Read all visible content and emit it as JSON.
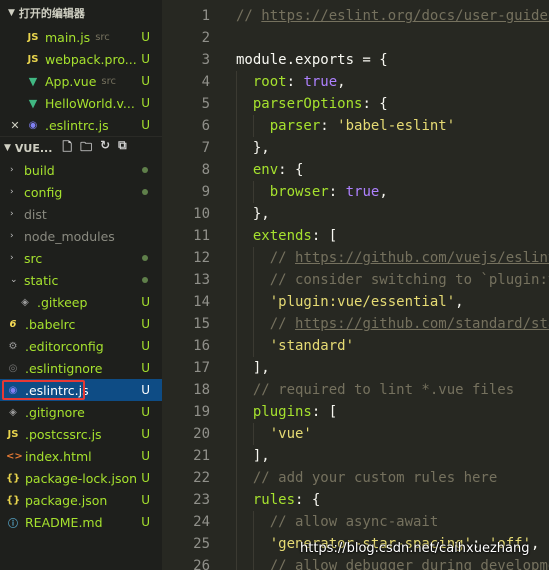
{
  "sidebar": {
    "open_editors_title": "打开的编辑器",
    "open_editors": [
      {
        "icon": "JS",
        "icon_class": "i-js",
        "name": "main.js",
        "desc": "src",
        "status": "U",
        "close": false
      },
      {
        "icon": "JS",
        "icon_class": "i-js",
        "name": "webpack.pro...",
        "desc": "",
        "status": "U",
        "close": false
      },
      {
        "icon": "▼",
        "icon_class": "i-vue",
        "name": "App.vue",
        "desc": "src",
        "status": "U",
        "close": false
      },
      {
        "icon": "▼",
        "icon_class": "i-vue",
        "name": "HelloWorld.v...",
        "desc": "",
        "status": "U",
        "close": false
      },
      {
        "icon": "◉",
        "icon_class": "i-eslint",
        "name": ".eslintrc.js",
        "desc": "",
        "status": "U",
        "close": true
      }
    ],
    "project_title": "VUE...",
    "project_tools": [
      "new-file-icon",
      "new-folder-icon",
      "refresh-icon",
      "collapse-all-icon"
    ],
    "tree": [
      {
        "kind": "folder",
        "caret": "›",
        "name": "build",
        "marker": "dot",
        "gray": false
      },
      {
        "kind": "folder",
        "caret": "›",
        "name": "config",
        "marker": "dot",
        "gray": false
      },
      {
        "kind": "folder",
        "caret": "›",
        "name": "dist",
        "marker": "",
        "gray": true
      },
      {
        "kind": "folder",
        "caret": "›",
        "name": "node_modules",
        "marker": "",
        "gray": true
      },
      {
        "kind": "folder",
        "caret": "›",
        "name": "src",
        "marker": "dot",
        "gray": false
      },
      {
        "kind": "folder",
        "caret": "⌄",
        "name": "static",
        "marker": "dot",
        "gray": false
      },
      {
        "kind": "file",
        "indent": true,
        "icon": "◈",
        "icon_class": "i-git",
        "name": ".gitkeep",
        "marker": "U"
      },
      {
        "kind": "file",
        "icon": "6",
        "icon_class": "i-babel",
        "name": ".babelrc",
        "marker": "U"
      },
      {
        "kind": "file",
        "icon": "⚙",
        "icon_class": "i-gear",
        "name": ".editorconfig",
        "marker": "U"
      },
      {
        "kind": "file",
        "icon": "◎",
        "icon_class": "i-ignore",
        "name": ".eslintignore",
        "marker": "U"
      },
      {
        "kind": "file",
        "icon": "◉",
        "icon_class": "i-eslint",
        "name": ".eslintrc.js",
        "marker": "U",
        "selected": true
      },
      {
        "kind": "file",
        "icon": "◈",
        "icon_class": "i-git",
        "name": ".gitignore",
        "marker": "U"
      },
      {
        "kind": "file",
        "icon": "JS",
        "icon_class": "i-js",
        "name": ".postcssrc.js",
        "marker": "U"
      },
      {
        "kind": "file",
        "icon": "<>",
        "icon_class": "i-html",
        "name": "index.html",
        "marker": "U"
      },
      {
        "kind": "file",
        "icon": "{}",
        "icon_class": "i-json",
        "name": "package-lock.json",
        "marker": "U"
      },
      {
        "kind": "file",
        "icon": "{}",
        "icon_class": "i-json",
        "name": "package.json",
        "marker": "U"
      },
      {
        "kind": "file",
        "icon": "ⓘ",
        "icon_class": "i-info",
        "name": "README.md",
        "marker": "U"
      }
    ]
  },
  "editor": {
    "lines": [
      {
        "n": "1",
        "indent": 0,
        "tokens": [
          [
            "t-com",
            "// "
          ],
          [
            "t-link",
            "https://eslint.org/docs/user-guide/configuring"
          ]
        ]
      },
      {
        "n": "2",
        "indent": 0,
        "tokens": []
      },
      {
        "n": "3",
        "indent": 0,
        "tokens": [
          [
            "t-plain",
            "module.exports = {"
          ]
        ]
      },
      {
        "n": "4",
        "indent": 1,
        "tokens": [
          [
            "t-key",
            "root"
          ],
          [
            "t-punc",
            ": "
          ],
          [
            "t-bool",
            "true"
          ],
          [
            "t-punc",
            ","
          ]
        ]
      },
      {
        "n": "5",
        "indent": 1,
        "tokens": [
          [
            "t-key",
            "parserOptions"
          ],
          [
            "t-punc",
            ": {"
          ]
        ]
      },
      {
        "n": "6",
        "indent": 2,
        "tokens": [
          [
            "t-key",
            "parser"
          ],
          [
            "t-punc",
            ": "
          ],
          [
            "t-str",
            "'babel-eslint'"
          ]
        ]
      },
      {
        "n": "7",
        "indent": 1,
        "tokens": [
          [
            "t-punc",
            "},"
          ]
        ]
      },
      {
        "n": "8",
        "indent": 1,
        "tokens": [
          [
            "t-key",
            "env"
          ],
          [
            "t-punc",
            ": {"
          ]
        ]
      },
      {
        "n": "9",
        "indent": 2,
        "tokens": [
          [
            "t-key",
            "browser"
          ],
          [
            "t-punc",
            ": "
          ],
          [
            "t-bool",
            "true"
          ],
          [
            "t-punc",
            ","
          ]
        ]
      },
      {
        "n": "10",
        "indent": 1,
        "tokens": [
          [
            "t-punc",
            "},"
          ]
        ]
      },
      {
        "n": "11",
        "indent": 1,
        "tokens": [
          [
            "t-key",
            "extends"
          ],
          [
            "t-punc",
            ": ["
          ]
        ]
      },
      {
        "n": "12",
        "indent": 2,
        "tokens": [
          [
            "t-com",
            "// "
          ],
          [
            "t-link",
            "https://github.com/vuejs/eslint-plugin-vue"
          ]
        ]
      },
      {
        "n": "13",
        "indent": 2,
        "tokens": [
          [
            "t-com",
            "// consider switching to `plugin:vue/strongly-recommended`"
          ]
        ]
      },
      {
        "n": "14",
        "indent": 2,
        "tokens": [
          [
            "t-str",
            "'plugin:vue/essential'"
          ],
          [
            "t-punc",
            ","
          ]
        ]
      },
      {
        "n": "15",
        "indent": 2,
        "tokens": [
          [
            "t-com",
            "// "
          ],
          [
            "t-link",
            "https://github.com/standard/standard"
          ]
        ]
      },
      {
        "n": "16",
        "indent": 2,
        "tokens": [
          [
            "t-str",
            "'standard'"
          ]
        ]
      },
      {
        "n": "17",
        "indent": 1,
        "tokens": [
          [
            "t-punc",
            "],"
          ]
        ]
      },
      {
        "n": "18",
        "indent": 1,
        "tokens": [
          [
            "t-com",
            "// required to lint *.vue files"
          ]
        ]
      },
      {
        "n": "19",
        "indent": 1,
        "tokens": [
          [
            "t-key",
            "plugins"
          ],
          [
            "t-punc",
            ": ["
          ]
        ]
      },
      {
        "n": "20",
        "indent": 2,
        "tokens": [
          [
            "t-str",
            "'vue'"
          ]
        ]
      },
      {
        "n": "21",
        "indent": 1,
        "tokens": [
          [
            "t-punc",
            "],"
          ]
        ]
      },
      {
        "n": "22",
        "indent": 1,
        "tokens": [
          [
            "t-com",
            "// add your custom rules here"
          ]
        ]
      },
      {
        "n": "23",
        "indent": 1,
        "tokens": [
          [
            "t-key",
            "rules"
          ],
          [
            "t-punc",
            ": {"
          ]
        ]
      },
      {
        "n": "24",
        "indent": 2,
        "tokens": [
          [
            "t-com",
            "// allow async-await"
          ]
        ]
      },
      {
        "n": "25",
        "indent": 2,
        "tokens": [
          [
            "t-str",
            "'generator-star-spacing'"
          ],
          [
            "t-punc",
            ": "
          ],
          [
            "t-str",
            "'off'"
          ],
          [
            "t-punc",
            ","
          ]
        ]
      },
      {
        "n": "26",
        "indent": 2,
        "tokens": [
          [
            "t-com",
            "// allow debugger during development"
          ]
        ]
      }
    ]
  },
  "watermark": "https://blog.csdn.net/caihxuezhang"
}
